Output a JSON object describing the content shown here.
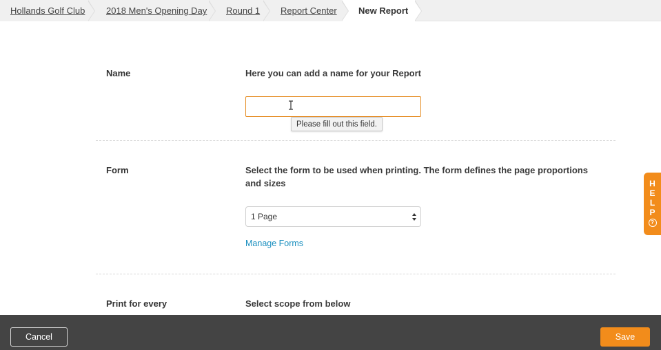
{
  "breadcrumb": {
    "items": [
      {
        "label": "Hollands Golf Club"
      },
      {
        "label": "2018 Men's Opening Day"
      },
      {
        "label": "Round 1"
      },
      {
        "label": "Report Center"
      },
      {
        "label": "New Report"
      }
    ]
  },
  "sections": {
    "name": {
      "label": "Name",
      "description": "Here you can add a name for your Report",
      "input_value": "",
      "validation_message": "Please fill out this field."
    },
    "form": {
      "label": "Form",
      "description": "Select the form to be used when printing. The form defines the page proportions and sizes",
      "selected_option": "1 Page",
      "manage_link": "Manage Forms"
    },
    "print_for_every": {
      "label": "Print for every",
      "description": "Select scope from below"
    }
  },
  "help_tab": {
    "letters": [
      "H",
      "E",
      "L",
      "P"
    ],
    "icon": "question-circle-icon"
  },
  "footer": {
    "cancel_label": "Cancel",
    "save_label": "Save"
  },
  "colors": {
    "accent": "#f28c1b",
    "link": "#1a8fbf",
    "footer_bg": "#444444",
    "input_focus_border": "#e58a1f"
  }
}
